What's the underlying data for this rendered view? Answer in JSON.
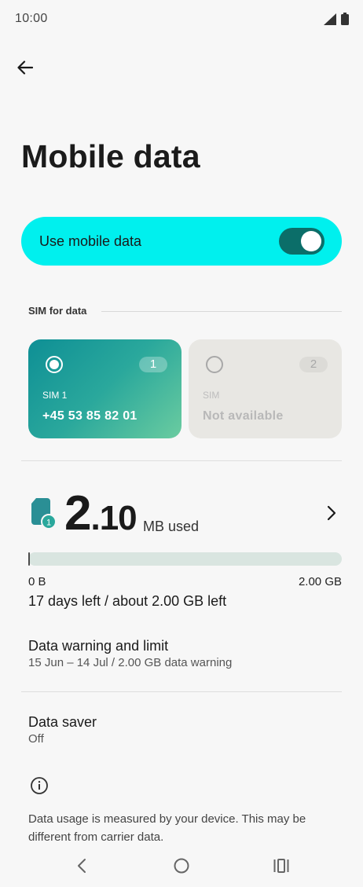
{
  "status_bar": {
    "time": "10:00",
    "signal_icon": "signal-icon",
    "battery_icon": "battery-icon"
  },
  "header": {
    "back_icon": "arrow-left-icon",
    "title": "Mobile data"
  },
  "mobile_data_toggle": {
    "label": "Use mobile data",
    "enabled": true,
    "accent": "#00f0ee",
    "switch_color": "#0b6e69"
  },
  "sim_section": {
    "label": "SIM for data",
    "cards": [
      {
        "slot": "1",
        "name": "SIM 1",
        "number": "+45 53 85 82 01",
        "selected": true
      },
      {
        "slot": "2",
        "name": "SIM",
        "number": "Not available",
        "selected": false
      }
    ]
  },
  "usage": {
    "sim_slot": "1",
    "amount_int": "2",
    "amount_dec": ".10",
    "unit": "MB used",
    "bar_fraction": 0.001,
    "bar_min": "0 B",
    "bar_max": "2.00 GB",
    "remaining": "17 days left / about 2.00 GB left"
  },
  "warning_row": {
    "title": "Data warning and limit",
    "subtitle": "15 Jun – 14 Jul / 2.00 GB data warning"
  },
  "saver_row": {
    "title": "Data saver",
    "subtitle": "Off"
  },
  "info": {
    "icon": "info-icon",
    "text": "Data usage is measured by your device. This may be different from carrier data."
  },
  "nav_bar": {
    "back": "nav-back-icon",
    "home": "nav-home-icon",
    "recents": "nav-recents-icon"
  }
}
